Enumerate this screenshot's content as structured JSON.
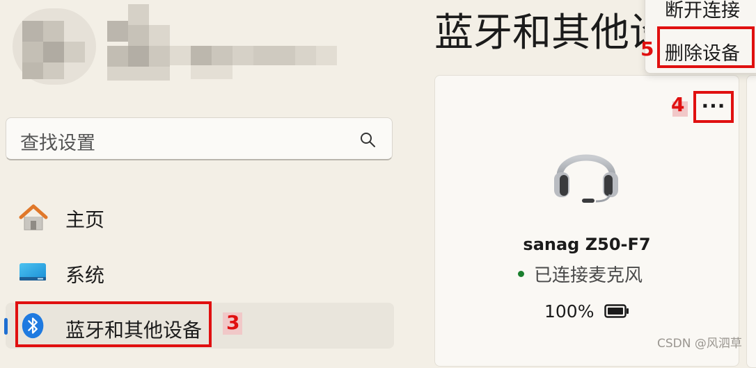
{
  "search": {
    "placeholder": "查找设置"
  },
  "nav": {
    "items": [
      {
        "label": "主页",
        "icon": "home-icon"
      },
      {
        "label": "系统",
        "icon": "system-display-icon"
      },
      {
        "label": "蓝牙和其他设备",
        "icon": "bluetooth-icon",
        "selected": true
      }
    ]
  },
  "page": {
    "title": "蓝牙和其他设备"
  },
  "device": {
    "name": "sanag Z50-F7",
    "status": "已连接麦克风",
    "battery": "100%",
    "icon": "headset-icon",
    "status_color": "#1a7f2e"
  },
  "context_menu": {
    "items": [
      {
        "label": "断开连接"
      },
      {
        "label": "删除设备"
      }
    ]
  },
  "annotations": {
    "step3": "3",
    "step4": "4",
    "step5": "5",
    "color": "#e01010"
  },
  "watermark": "CSDN @风泗草",
  "colors": {
    "accent": "#1f6fd1",
    "background": "#f3efe6"
  }
}
